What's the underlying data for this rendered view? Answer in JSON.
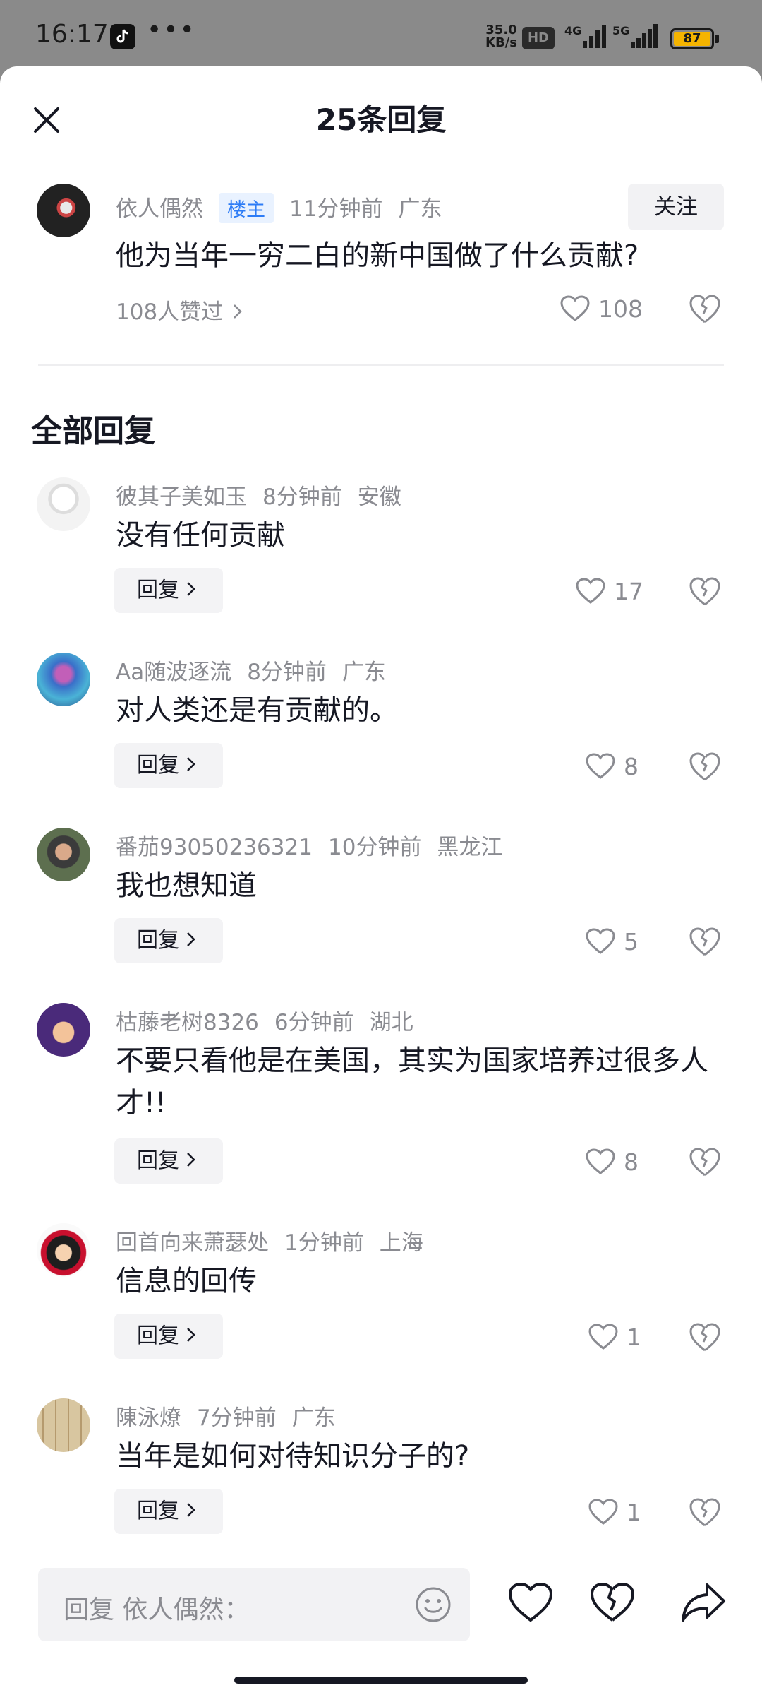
{
  "status_bar": {
    "time": "16:17",
    "dots": "•••",
    "speed_value": "35.0",
    "speed_unit": "KB/s",
    "hd": "HD",
    "net1": "4G",
    "net2": "5G",
    "battery": "87"
  },
  "sheet": {
    "title": "25条回复"
  },
  "original_comment": {
    "username": "依人偶然",
    "badge": "楼主",
    "time": "11分钟前",
    "location": "广东",
    "follow_label": "关注",
    "text": "他为当年一穷二白的新中国做了什么贡献?",
    "likers_text": "108人赞过",
    "like_count": "108"
  },
  "section_title": "全部回复",
  "reply_label": "回复",
  "replies": [
    {
      "username": "彼其子美如玉",
      "time": "8分钟前",
      "location": "安徽",
      "text": "没有任何贡献",
      "likes": "17"
    },
    {
      "username": "Aa随波逐流",
      "time": "8分钟前",
      "location": "广东",
      "text": "对人类还是有贡献的。",
      "likes": "8"
    },
    {
      "username": "番茄93050236321",
      "time": "10分钟前",
      "location": "黑龙江",
      "text": "我也想知道",
      "likes": "5"
    },
    {
      "username": "枯藤老树8326",
      "time": "6分钟前",
      "location": "湖北",
      "text": "不要只看他是在美国，其实为国家培养过很多人才!!",
      "likes": "8"
    },
    {
      "username": "回首向来萧瑟处",
      "time": "1分钟前",
      "location": "上海",
      "text": "信息的回传",
      "likes": "1"
    },
    {
      "username": "陳泳燎",
      "time": "7分钟前",
      "location": "广东",
      "text": "当年是如何对待知识分子的?",
      "likes": "1"
    }
  ],
  "bottom_bar": {
    "placeholder": "回复 依人偶然："
  },
  "colors": {
    "accent_blue": "#2d7cf6",
    "text_primary": "#161823",
    "text_secondary": "#8a8b91"
  }
}
